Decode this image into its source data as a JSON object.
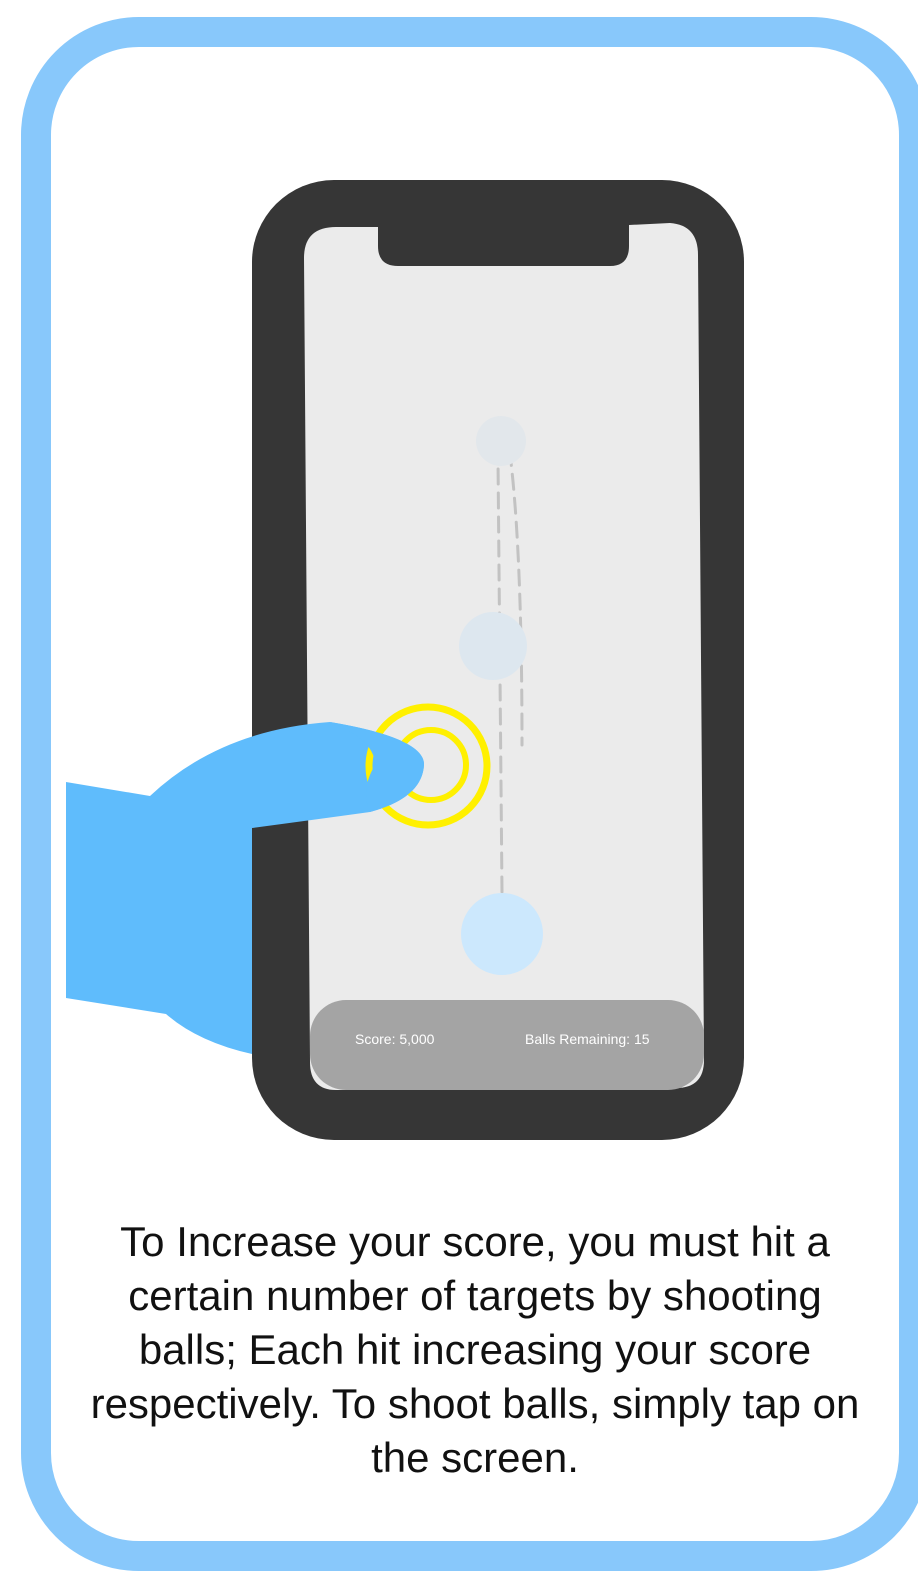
{
  "game": {
    "hud": {
      "score_text": "Score: 5,000",
      "balls_remaining_text": "Balls Remaining: 15"
    }
  },
  "instructions": {
    "text": "To Increase your score, you must hit a certain number of targets by shooting balls; Each hit increasing your score respectively. To shoot balls, simply tap on the screen."
  },
  "colors": {
    "card_border": "#88c8fb",
    "phone_body": "#363636",
    "screen": "#ebebeb",
    "hud_bar": "#a4a4a4",
    "hand": "#5fbcfc",
    "tap_rings": "#fff000",
    "ball": "#cce8fd"
  }
}
